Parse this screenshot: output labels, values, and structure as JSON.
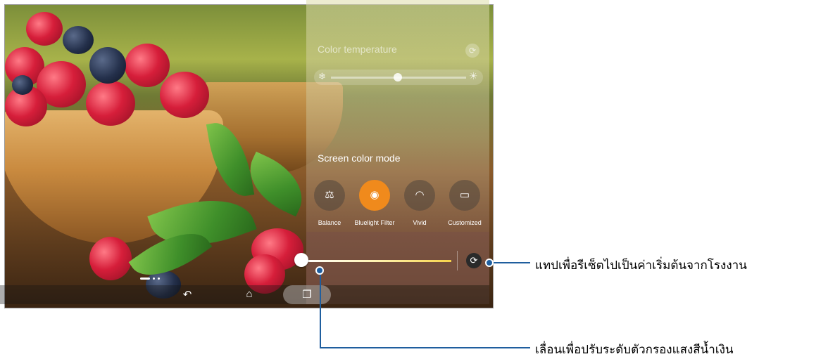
{
  "panel": {
    "color_temperature_title": "Color temperature",
    "screen_color_mode_title": "Screen color mode",
    "modes": [
      {
        "label": "Balance",
        "icon": "balance-scale-icon",
        "glyph": "⚖",
        "active": false
      },
      {
        "label": "Bluelight Filter",
        "icon": "eye-shield-icon",
        "glyph": "◉",
        "active": true
      },
      {
        "label": "Vivid",
        "icon": "rainbow-icon",
        "glyph": "◠",
        "active": false
      },
      {
        "label": "Customized",
        "icon": "custom-screen-icon",
        "glyph": "▭",
        "active": false
      }
    ],
    "icons": {
      "cold": "❄",
      "warm": "☀",
      "reset": "⟳"
    }
  },
  "navbar": {
    "back": "↶",
    "home": "⌂",
    "recents": "❐"
  },
  "callouts": {
    "reset_text": "แทปเพื่อรีเซ็ตไปเป็นค่าเริ่มต้นจากโรงงาน",
    "slider_text": "เลื่อนเพื่อปรับระดับตัวกรองแสงสีน้ำเงิน"
  },
  "colors": {
    "accent": "#f08a1c",
    "callout_line": "#1f5e9e"
  }
}
